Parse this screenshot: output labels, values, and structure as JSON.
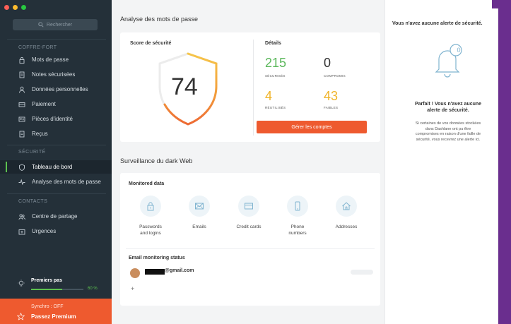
{
  "sidebar": {
    "search_placeholder": "Rechercher",
    "section_vault": "COFFRE-FORT",
    "section_security": "SÉCURITÉ",
    "section_contacts": "CONTACTS",
    "items": [
      {
        "label": "Mots de passe",
        "icon": "lock-icon"
      },
      {
        "label": "Notes sécurisées",
        "icon": "note-icon"
      },
      {
        "label": "Données personnelles",
        "icon": "person-icon"
      },
      {
        "label": "Paiement",
        "icon": "card-icon"
      },
      {
        "label": "Pièces d'identité",
        "icon": "id-card-icon"
      },
      {
        "label": "Reçus",
        "icon": "receipt-icon"
      },
      {
        "label": "Tableau de bord",
        "icon": "shield-icon"
      },
      {
        "label": "Analyse des mots de passe",
        "icon": "pulse-icon"
      },
      {
        "label": "Centre de partage",
        "icon": "people-icon"
      },
      {
        "label": "Urgences",
        "icon": "emergency-icon"
      }
    ],
    "first_steps": {
      "label": "Premiers pas",
      "progress_pct": 60,
      "progress_text": "60 %"
    },
    "sync": "Synchro : OFF",
    "premium": "Passez Premium"
  },
  "main": {
    "title": "Analyse des mots de passe",
    "score_card": {
      "title": "Score de sécurité",
      "score": "74"
    },
    "details": {
      "title": "Détails",
      "stats": [
        {
          "value": "215",
          "label": "SÉCURISÉS",
          "color": "#5cb85c"
        },
        {
          "value": "0",
          "label": "COMPROMIS",
          "color": "#333333"
        },
        {
          "value": "4",
          "label": "RÉUTILISÉS",
          "color": "#f0b429"
        },
        {
          "value": "43",
          "label": "FAIBLES",
          "color": "#f0b429"
        }
      ],
      "button": "Gérer les comptes"
    },
    "darkweb": {
      "title": "Surveillance du dark Web",
      "monitored_title": "Monitored data",
      "items": [
        {
          "label_line1": "Passwords",
          "label_line2": "and logins",
          "icon": "lock-icon"
        },
        {
          "label_line1": "Emails",
          "label_line2": "",
          "icon": "envelope-icon"
        },
        {
          "label_line1": "Credit cards",
          "label_line2": "",
          "icon": "card-icon"
        },
        {
          "label_line1": "Phone",
          "label_line2": "numbers",
          "icon": "phone-icon"
        },
        {
          "label_line1": "Addresses",
          "label_line2": "",
          "icon": "home-icon"
        }
      ],
      "status_title": "Email monitoring status",
      "email_suffix": "@gmail.com",
      "add": "+"
    }
  },
  "alerts": {
    "title": "Vous n'avez aucune alerte de sécurité.",
    "bell_badge": "0",
    "perfect_line1": "Parfait ! Vous n'avez aucune",
    "perfect_line2": "alerte de sécurité.",
    "desc_line1": "Si certaines de vos données stockées",
    "desc_line2": "dans Dashlane ont pu être",
    "desc_line3": "compromises en raison d'une faille de",
    "desc_line4": "sécurité, vous recevrez une alerte ici."
  },
  "colors": {
    "sidebar_bg": "#243039",
    "accent_orange": "#ee5a2f",
    "accent_green": "#5cc14f",
    "icon_blue": "#7fb3cf"
  }
}
